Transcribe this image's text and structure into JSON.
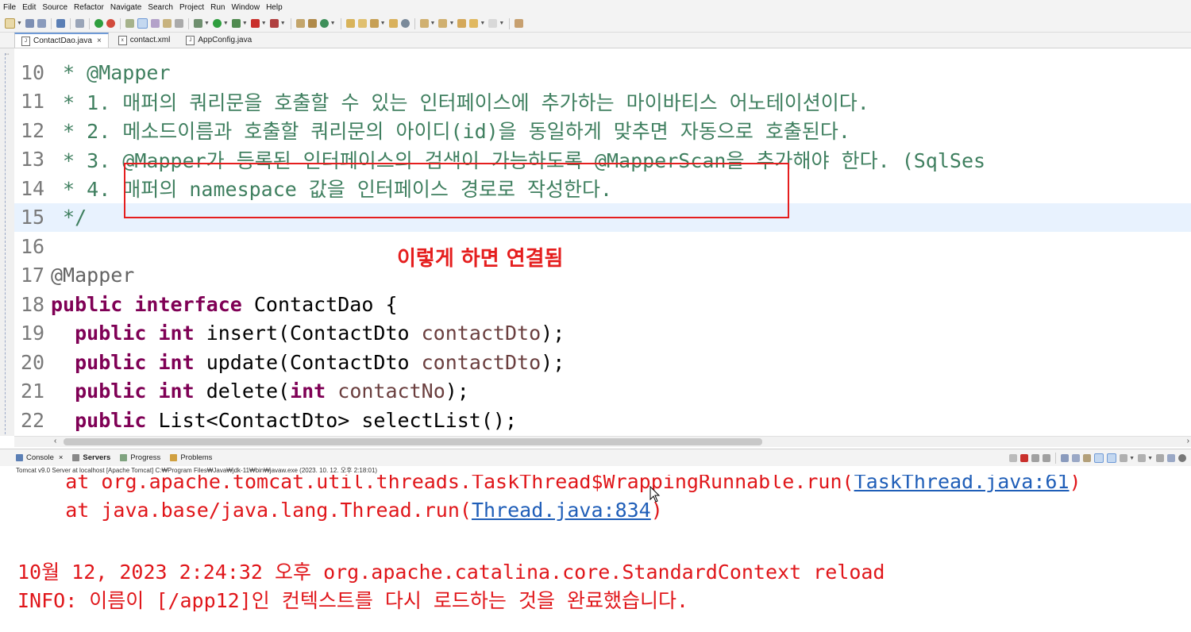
{
  "menu": [
    "File",
    "Edit",
    "Source",
    "Refactor",
    "Navigate",
    "Search",
    "Project",
    "Run",
    "Window",
    "Help"
  ],
  "editor_tabs": [
    {
      "label": "ContactDao.java",
      "icon": "J",
      "active": true,
      "close": "×"
    },
    {
      "label": "contact.xml",
      "icon": "x",
      "active": false
    },
    {
      "label": "AppConfig.java",
      "icon": "J",
      "active": false
    }
  ],
  "code": {
    "lines": [
      {
        "num": "10",
        "text": " * @Mapper"
      },
      {
        "num": "11",
        "text": " * 1. 매퍼의 쿼리문을 호출할 수 있는 인터페이스에 추가하는 마이바티스 어노테이션이다."
      },
      {
        "num": "12",
        "text": " * 2. 메소드이름과 호출할 쿼리문의 아이디(id)을 동일하게 맞추면 자동으로 호출된다."
      },
      {
        "num": "13",
        "text": " * 3. @Mapper가 등록된 인터페이스의 검색이 가능하도록 @MapperScan을 추가해야 한다. (SqlSes"
      },
      {
        "num": "14",
        "text": " * 4. 매퍼의 namespace 값을 인터페이스 경로로 작성한다."
      },
      {
        "num": "15",
        "text": " */"
      },
      {
        "num": "16",
        "text": ""
      },
      {
        "num": "17",
        "text": "@Mapper"
      },
      {
        "num": "18",
        "kw": "public interface",
        "rest": " ContactDao {"
      },
      {
        "num": "19",
        "kw1": "public",
        "kw2": "int",
        "method": " insert(ContactDto ",
        "param": "contactDto",
        "end": ");"
      },
      {
        "num": "20",
        "kw1": "public",
        "kw2": "int",
        "method": " update(ContactDto ",
        "param": "contactDto",
        "end": ");"
      },
      {
        "num": "21",
        "kw1": "public",
        "kw2": "int",
        "method": " delete(",
        "kw3": "int",
        "param": "contactNo",
        "end": ");"
      },
      {
        "num": "22",
        "kw1": "public",
        "rest": " List<ContactDto> selectList();"
      }
    ]
  },
  "annotation_note": "이렇게 하면 연결됨",
  "console_tabs": [
    {
      "label": "Console",
      "close": "×",
      "active": false
    },
    {
      "label": "Servers",
      "active": true
    },
    {
      "label": "Progress",
      "active": false
    },
    {
      "label": "Problems",
      "active": false
    }
  ],
  "console_header": "Tomcat v9.0 Server at localhost [Apache Tomcat] C:₩Program Files₩Java₩jdk-11₩bin₩javaw.exe  (2023. 10. 12. 오후 2:18:01)",
  "console": {
    "line1_prefix": "    at org.apache.tomcat.util.threads.TaskThread$WrappingRunnable.run(",
    "line1_link": "TaskThread.java:61",
    "line1_suffix": ")",
    "line2_prefix": "    at java.base/java.lang.Thread.run(",
    "line2_link": "Thread.java:834",
    "line2_suffix": ")",
    "line3": "10월 12, 2023 2:24:32 오후 org.apache.catalina.core.StandardContext reload",
    "line4": "INFO: 이름이 [/app12]인 컨텍스트를 다시 로드하는 것을 완료했습니다."
  },
  "colors": {
    "comment": "#3f7f5f",
    "keyword": "#7f0055",
    "param": "#6a3e3e",
    "console_error": "#e0161a",
    "annotation_red": "#e51e1e",
    "link": "#1f5eb8"
  }
}
